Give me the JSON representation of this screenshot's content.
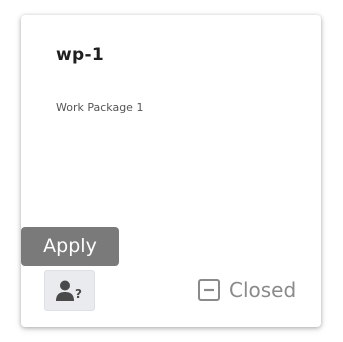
{
  "card": {
    "title": "wp-1",
    "description": "Work Package 1"
  },
  "tooltip": {
    "label": "Apply"
  },
  "assign_button": {
    "icon": "person-question-icon"
  },
  "status": {
    "icon": "minus-square-icon",
    "label": "Closed"
  }
}
